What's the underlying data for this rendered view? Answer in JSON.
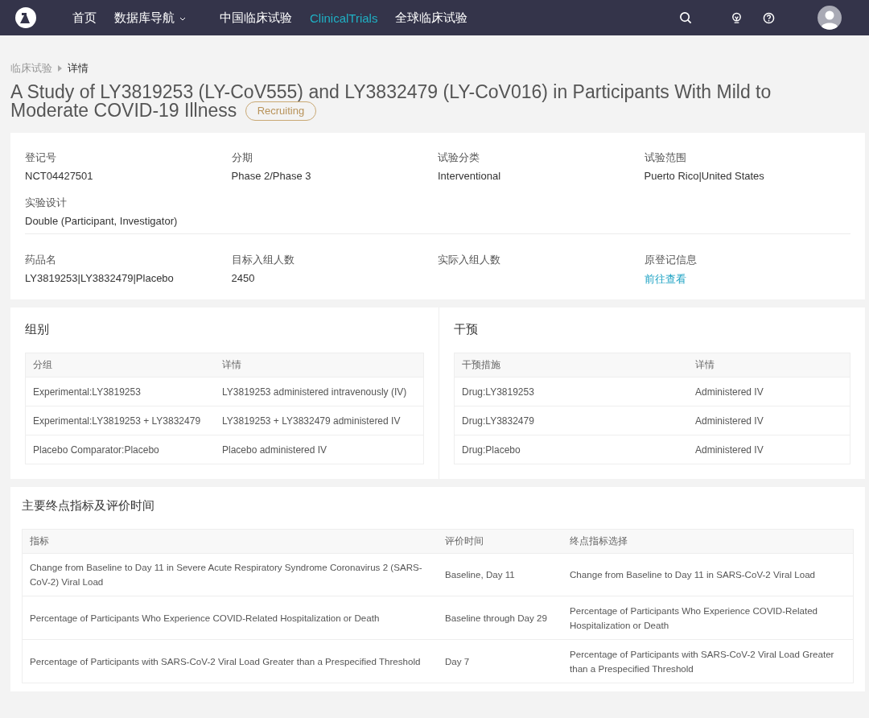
{
  "nav": {
    "items": [
      {
        "label": "首页",
        "selected": false,
        "dropdown": false
      },
      {
        "label": "数据库导航",
        "selected": false,
        "dropdown": true
      },
      {
        "label": "中国临床试验",
        "selected": false,
        "dropdown": false
      },
      {
        "label": "ClinicalTrials",
        "selected": true,
        "dropdown": false
      },
      {
        "label": "全球临床试验",
        "selected": false,
        "dropdown": false
      }
    ]
  },
  "breadcrumb": [
    "临床试验",
    "详情"
  ],
  "title": "A Study of LY3819253 (LY-CoV555) and LY3832479 (LY-CoV016) in Participants With Mild to Moderate COVID-19 Illness",
  "status": "Recruiting",
  "info": {
    "groups": [
      [
        {
          "label": "登记号",
          "value": "NCT04427501",
          "kind": "text"
        },
        {
          "label": "分期",
          "value": "Phase 2/Phase 3",
          "kind": "text"
        },
        {
          "label": "试验分类",
          "value": "Interventional",
          "kind": "text"
        },
        {
          "label": "试验范围",
          "value": "Puerto Rico|United States",
          "kind": "text"
        },
        {
          "label": "实验设计",
          "value": "Double (Participant, Investigator)",
          "kind": "text"
        }
      ],
      [
        {
          "label": "药品名",
          "value": "LY3819253|LY3832479|Placebo",
          "kind": "text"
        },
        {
          "label": "目标入组人数",
          "value": "2450",
          "kind": "text"
        },
        {
          "label": "实际入组人数"
        },
        {
          "label": "原登记信息",
          "value": "前往查看",
          "kind": "link"
        }
      ]
    ]
  },
  "arms": {
    "title": "组别",
    "columns": [
      "分组",
      "详情"
    ],
    "rows": [
      [
        "Experimental:LY3819253",
        "LY3819253 administered intravenously (IV)"
      ],
      [
        "Experimental:LY3819253 + LY3832479",
        "LY3819253 + LY3832479 administered IV"
      ],
      [
        "Placebo Comparator:Placebo",
        "Placebo administered IV"
      ]
    ]
  },
  "interventions": {
    "title": "干预",
    "columns": [
      "干预措施",
      "详情"
    ],
    "rows": [
      [
        "Drug:LY3819253",
        "Administered IV"
      ],
      [
        "Drug:LY3832479",
        "Administered IV"
      ],
      [
        "Drug:Placebo",
        "Administered IV"
      ]
    ]
  },
  "outcomes": {
    "title": "主要终点指标及评价时间",
    "columns": [
      "指标",
      "评价时间",
      "终点指标选择"
    ],
    "rows": [
      [
        "Change from Baseline to Day 11 in Severe Acute Respiratory Syndrome Coronavirus 2 (SARS-CoV-2) Viral Load",
        "Baseline, Day 11",
        "Change from Baseline to Day 11 in SARS-CoV-2 Viral Load"
      ],
      [
        "Percentage of Participants Who Experience COVID-Related Hospitalization or Death",
        "Baseline through Day 29",
        "Percentage of Participants Who Experience COVID-Related Hospitalization or Death"
      ],
      [
        "Percentage of Participants with SARS-CoV-2 Viral Load Greater than a Prespecified Threshold",
        "Day 7",
        "Percentage of Participants with SARS-CoV-2 Viral Load Greater than a Prespecified Threshold"
      ]
    ]
  }
}
